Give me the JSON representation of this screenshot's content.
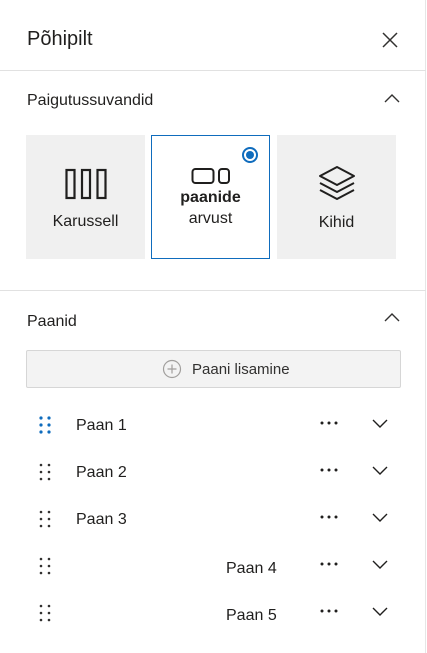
{
  "header": {
    "title": "Põhipilt",
    "close_icon": "close-icon"
  },
  "layout_section": {
    "title": "Paigutussuvandid",
    "options": [
      {
        "label": "Karussell",
        "icon": "carousel-icon",
        "selected": false
      },
      {
        "label_line1": "paanide",
        "label_line2": "arvust",
        "icon": "tiles-icon",
        "selected": true
      },
      {
        "label": "Kihid",
        "icon": "layers-icon",
        "selected": false
      }
    ]
  },
  "tiles_section": {
    "title": "Paanid",
    "add_button": {
      "label": "Paani lisamine",
      "icon": "add-circle-icon"
    },
    "items": [
      {
        "label": "Paan 1"
      },
      {
        "label": "Paan 2"
      },
      {
        "label": "Paan 3"
      },
      {
        "label": "Paan 4"
      },
      {
        "label": "Paan 5"
      }
    ]
  },
  "colors": {
    "accent": "#0f6cbd",
    "tile_bg": "#f0f0f0",
    "text": "#201f1e"
  }
}
